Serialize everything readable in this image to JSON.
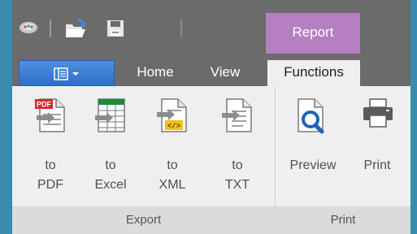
{
  "context_tab": {
    "label": "Report"
  },
  "tabs": [
    {
      "label": "Home"
    },
    {
      "label": "View"
    },
    {
      "label": "Functions"
    }
  ],
  "export_group": {
    "label": "Export",
    "buttons": [
      {
        "line1": "to",
        "line2": "PDF",
        "icon": "pdf-export-icon",
        "badge": "PDF"
      },
      {
        "line1": "to",
        "line2": "Excel",
        "icon": "excel-export-icon"
      },
      {
        "line1": "to",
        "line2": "XML",
        "icon": "xml-export-icon",
        "badge": "</>"
      },
      {
        "line1": "to",
        "line2": "TXT",
        "icon": "txt-export-icon"
      }
    ]
  },
  "print_group": {
    "label": "Print",
    "buttons": [
      {
        "label": "Preview",
        "icon": "print-preview-icon"
      },
      {
        "label": "Print",
        "icon": "printer-icon"
      }
    ]
  },
  "colors": {
    "context_tab": "#b67fc1",
    "app_menu": "#3a7ed6",
    "titlebar": "#6b6b6b",
    "ribbon": "#f0eef0"
  }
}
